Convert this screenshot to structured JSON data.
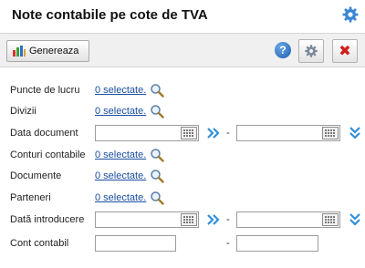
{
  "header": {
    "title": "Note contabile pe cote de TVA"
  },
  "toolbar": {
    "generate_label": "Genereaza",
    "help_label": "?"
  },
  "filters": {
    "puncte_lucru": {
      "label": "Puncte de lucru",
      "link": "0 selectate."
    },
    "divizii": {
      "label": "Divizii",
      "link": "0 selectate."
    },
    "data_document": {
      "label": "Data document",
      "dash": "-"
    },
    "conturi_contabile": {
      "label": "Conturi contabile",
      "link": "0 selectate."
    },
    "documente": {
      "label": "Documente",
      "link": "0 selectate."
    },
    "parteneri": {
      "label": "Parteneri",
      "link": "0 selectate."
    },
    "data_introducere": {
      "label": "Dată introducere",
      "dash": "-"
    },
    "cont_contabil": {
      "label": "Cont contabil",
      "dash": "-"
    }
  },
  "colors": {
    "accent": "#1a4fa0",
    "close": "#d11b1b",
    "chevron": "#2f8fd8"
  }
}
